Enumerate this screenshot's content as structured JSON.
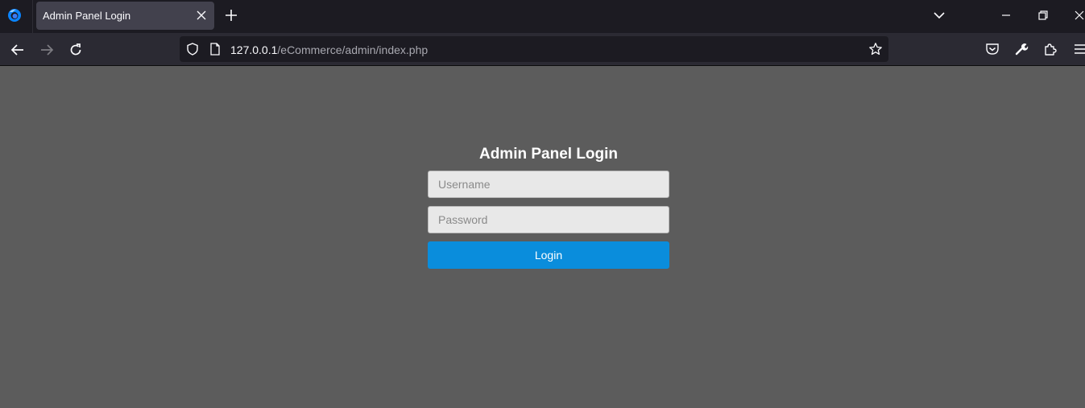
{
  "browser": {
    "tab": {
      "title": "Admin Panel Login"
    },
    "url": {
      "host": "127.0.0.1",
      "path": "/eCommerce/admin/index.php"
    }
  },
  "page": {
    "background": "#5c5c5c",
    "login_form": {
      "heading": "Admin Panel Login",
      "username_placeholder": "Username",
      "password_placeholder": "Password",
      "submit_label": "Login",
      "accent_color": "#0a8ddc"
    }
  }
}
